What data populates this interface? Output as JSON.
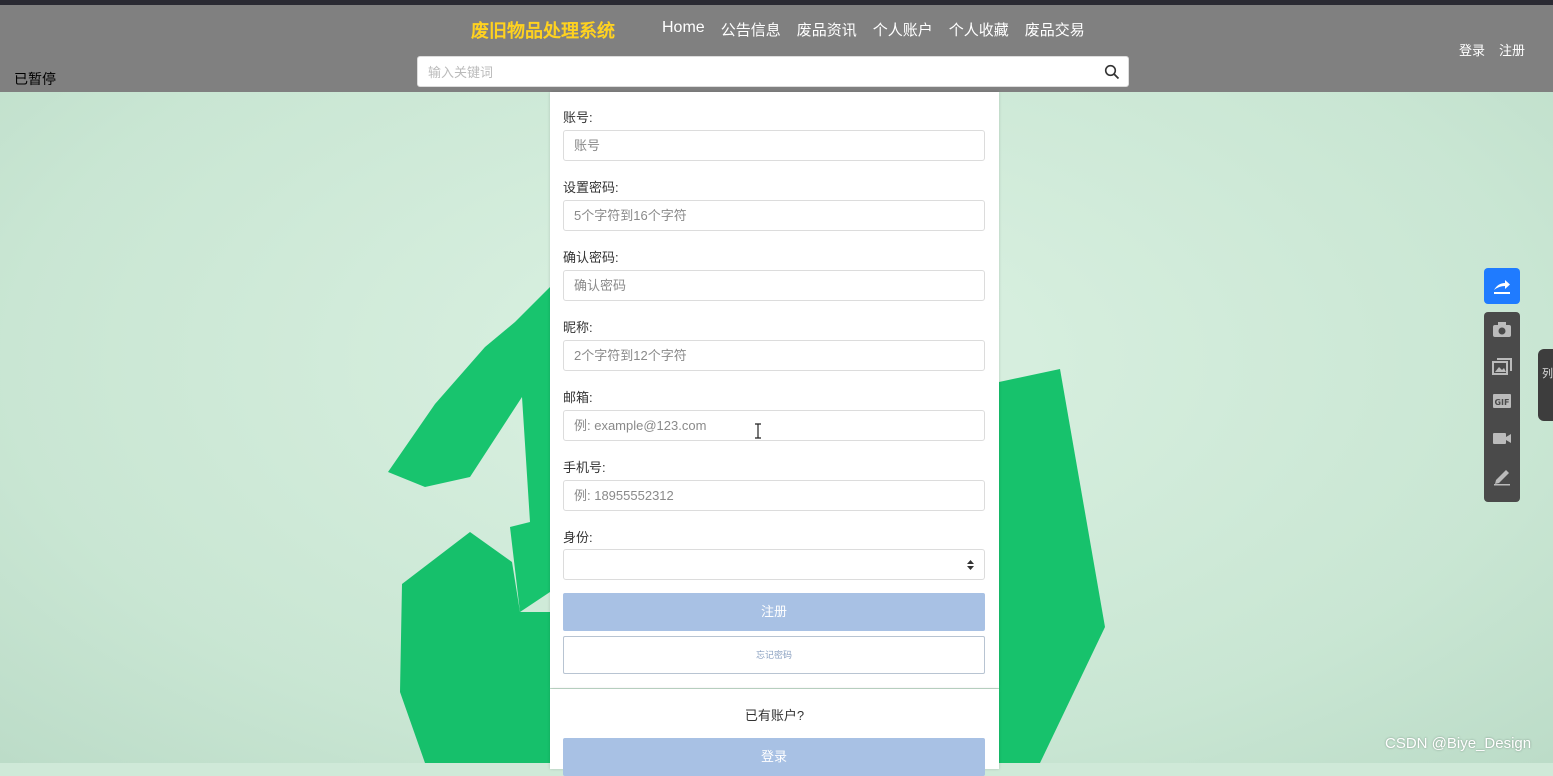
{
  "header": {
    "brand": "废旧物品处理系统",
    "nav": [
      "Home",
      "公告信息",
      "废品资讯",
      "个人账户",
      "个人收藏",
      "废品交易"
    ],
    "login": "登录",
    "register": "注册",
    "paused": "已暂停",
    "search_placeholder": "输入关键词"
  },
  "form": {
    "account_label": "账号:",
    "account_placeholder": "账号",
    "password_label": "设置密码:",
    "password_placeholder": "5个字符到16个字符",
    "confirm_label": "确认密码:",
    "confirm_placeholder": "确认密码",
    "nickname_label": "昵称:",
    "nickname_placeholder": "2个字符到12个字符",
    "email_label": "邮箱:",
    "email_placeholder": "例: example@123.com",
    "phone_label": "手机号:",
    "phone_placeholder": "例: 18955552312",
    "identity_label": "身份:",
    "identity_value": "",
    "register_button": "注册",
    "forgot_button": "忘记密码"
  },
  "login_panel": {
    "prompt": "已有账户?",
    "login_button": "登录"
  },
  "overlay": {
    "side_tab": "列",
    "watermark": "CSDN @Biye_Design"
  },
  "colors": {
    "header_bg": "#808080",
    "brand": "#ffd21f",
    "primary_button": "#a8c1e4",
    "recycle_green": "#18c46e",
    "share_button": "#1f7bff"
  }
}
